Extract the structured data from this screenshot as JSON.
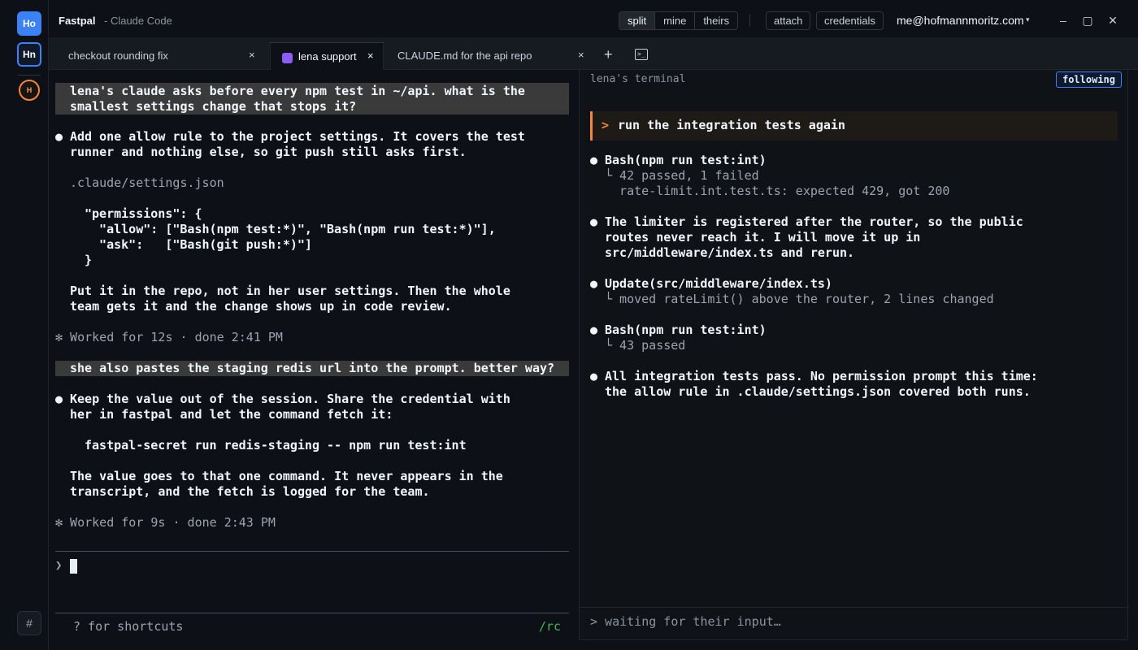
{
  "rail": {
    "workspaces": [
      "Ho",
      "Hn",
      "H"
    ],
    "bottom_icon": "#"
  },
  "titlebar": {
    "app_name": "Fastpal",
    "app_sub": "- Claude Code",
    "view_modes": [
      "split",
      "mine",
      "theirs"
    ],
    "active_view": "split",
    "attach_label": "attach",
    "credentials_label": "credentials",
    "user_email": "me@hofmannmoritz.com",
    "caret_icon": "chevron-down-icon",
    "window_buttons": [
      "–",
      "▢",
      "✕"
    ]
  },
  "tabs": [
    {
      "label": "checkout rounding fix",
      "active": false
    },
    {
      "label": "lena support",
      "active": true,
      "color": "#8b5cf6"
    },
    {
      "label": "CLAUDE.md for the api repo",
      "active": false
    }
  ],
  "tab_close": "×",
  "tab_add": "+",
  "chat": {
    "q1": [
      "lena's claude asks before every npm test in ~/api. what is the",
      "smallest settings change that stops it?"
    ],
    "a1": [
      "Add one allow rule to the project settings. It covers the test",
      "runner and nothing else, so git push still asks first."
    ],
    "file_path": ".claude/settings.json",
    "code": [
      "\"permissions\": {",
      "  \"allow\": [\"Bash(npm test:*)\", \"Bash(npm run test:*)\"],",
      "  \"ask\":   [\"Bash(git push:*)\"]",
      "}"
    ],
    "a1b": [
      "Put it in the repo, not in her user settings. Then the whole",
      "team gets it and the change shows up in code review."
    ],
    "worked1": "✻ Worked for 12s · done 2:41 PM",
    "q2": "she also pastes the staging redis url into the prompt. better way?",
    "a2": [
      "Keep the value out of the session. Share the credential with",
      "her in fastpal and let the command fetch it:"
    ],
    "cmd": "fastpal-secret run redis-staging -- npm run test:int",
    "a2b": [
      "The value goes to that one command. It never appears in the",
      "transcript, and the fetch is logged for the team."
    ],
    "worked2": "✻ Worked for 9s · done 2:43 PM",
    "bullet": "●",
    "prompt_arrow": "❯",
    "shortcuts": "? for shortcuts",
    "rc": "/rc"
  },
  "terminal": {
    "title": "lena's terminal",
    "following": "following",
    "prompt_arrow": ">",
    "prompt": "run the integration tests again",
    "entries": [
      {
        "head": "Bash(npm run test:int)",
        "sub": [
          "└ 42 passed, 1 failed",
          "  rate-limit.int.test.ts: expected 429, got 200"
        ]
      },
      {
        "head": [
          "The limiter is registered after the router, so the public",
          "routes never reach it. I will move it up in",
          "src/middleware/index.ts and rerun."
        ]
      },
      {
        "head": "Update(src/middleware/index.ts)",
        "sub": [
          "└ moved rateLimit() above the router, 2 lines changed"
        ]
      },
      {
        "head": "Bash(npm run test:int)",
        "sub": [
          "└ 43 passed"
        ]
      },
      {
        "head": [
          "All integration tests pass. No permission prompt this time:",
          "the allow rule in .claude/settings.json covered both runs."
        ]
      }
    ],
    "input_placeholder": "> waiting for their input…"
  }
}
